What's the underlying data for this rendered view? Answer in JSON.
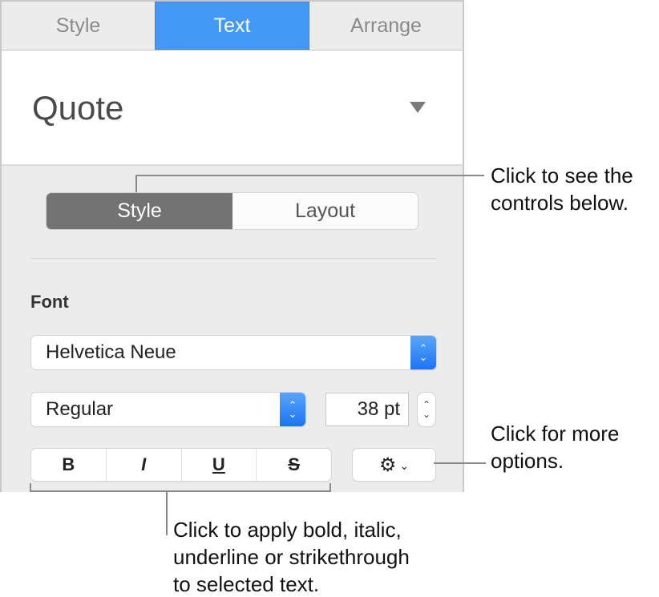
{
  "inspector": {
    "tabs": [
      {
        "label": "Style",
        "active": false
      },
      {
        "label": "Text",
        "active": true
      },
      {
        "label": "Arrange",
        "active": false
      }
    ],
    "paragraph_style": {
      "value": "Quote",
      "icon": "triangle-down-icon"
    },
    "segmented": [
      {
        "label": "Style",
        "selected": true
      },
      {
        "label": "Layout",
        "selected": false
      }
    ],
    "font": {
      "section_label": "Font",
      "family": "Helvetica Neue",
      "typeface": "Regular",
      "size": "38 pt"
    },
    "format_buttons": {
      "bold": "B",
      "italic": "I",
      "underline": "U",
      "strikethrough": "S"
    },
    "options_button": {
      "icon": "gear-icon",
      "chevron": "chevron-down-icon",
      "gear_glyph": "⚙",
      "chevron_glyph": "⌄"
    },
    "colors": {
      "accent": "#4499f7",
      "segment_selected": "#737373",
      "panel_bg": "#ececec"
    }
  },
  "callouts": {
    "segment": "Click to see the controls below.",
    "segment_lines": [
      "Click to see the",
      "controls below."
    ],
    "options_lines": [
      "Click for more",
      "options."
    ],
    "format_lines": [
      "Click to apply bold, italic,",
      "underline or strikethrough",
      "to selected text."
    ]
  }
}
